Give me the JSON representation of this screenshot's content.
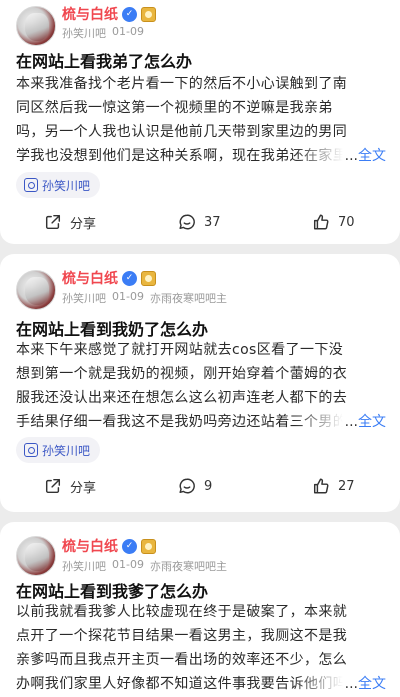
{
  "posts": [
    {
      "author": "梳与白纸",
      "forum_meta": "孙笑川吧",
      "date": "01-09",
      "role": "",
      "title": "在网站上看我弟了怎么办",
      "body_lines": [
        "本来我准备找个老片看一下的然后不小心误触到了南",
        "同区然后我一惊这第一个视频里的不逆嘛是我亲弟",
        "吗，另一个人我也认识是他前几天带到家里边的男同"
      ],
      "body_last": "学我也没想到他们是这种关系啊，现在我弟还在家里",
      "ellipsis": "...",
      "full_text": "全文",
      "forum_tag": "孙笑川吧",
      "share_label": "分享",
      "comments": "37",
      "likes": "70"
    },
    {
      "author": "梳与白纸",
      "forum_meta": "孙笑川吧",
      "date": "01-09",
      "role": "亦雨夜寒吧吧主",
      "title": "在网站上看到我奶了怎么办",
      "body_lines": [
        "本来下午来感觉了就打开网站就去cos区看了一下没",
        "想到第一个就是我奶的视频，刚开始穿着个蕾姆的衣",
        "服我还没认出来还在想怎么这么初声连老人都下的去"
      ],
      "body_last": "手结果仔细一看我这不是我奶吗旁边还站着三个男的",
      "ellipsis": "...",
      "full_text": "全文",
      "forum_tag": "孙笑川吧",
      "share_label": "分享",
      "comments": "9",
      "likes": "27"
    },
    {
      "author": "梳与白纸",
      "forum_meta": "孙笑川吧",
      "date": "01-09",
      "role": "亦雨夜寒吧吧主",
      "title": "在网站上看到我爹了怎么办",
      "body_lines": [
        "以前我就看我爹人比较虚现在终于是破案了，本来就",
        "点开了一个探花节目结果一看这男主，我厕这不是我",
        "亲爹吗而且我点开主页一看出场的效率还不少，怎么"
      ],
      "body_last": "办啊我们家里人好像都不知道这件事我要告诉他们吗",
      "ellipsis": "...",
      "full_text": "全文"
    }
  ],
  "colors": {
    "author": "#f0474f",
    "link": "#3b7df5",
    "tag_text": "#3b57c5",
    "background": "#ececec"
  },
  "icons": {
    "verified": "v-badge-icon",
    "level": "level-badge-icon",
    "share": "share-icon",
    "comment": "comment-icon",
    "like": "thumbs-up-icon",
    "forum": "forum-tag-icon"
  }
}
